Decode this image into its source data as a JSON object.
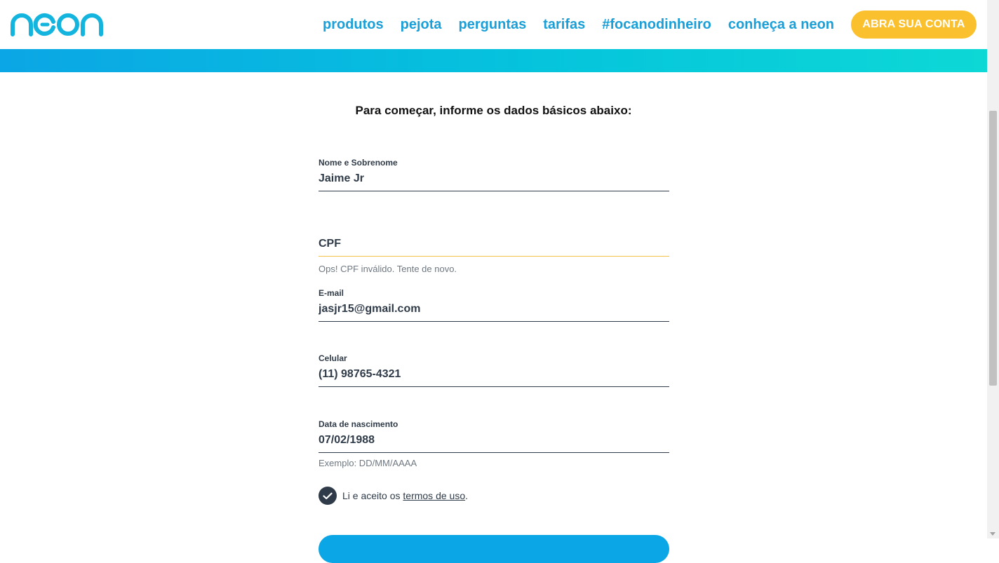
{
  "header": {
    "nav": [
      "produtos",
      "pejota",
      "perguntas",
      "tarifas",
      "#focanodinheiro",
      "conheça a neon"
    ],
    "cta": "ABRA SUA CONTA"
  },
  "form": {
    "title": "Para começar, informe os dados básicos abaixo:",
    "name": {
      "label": "Nome e Sobrenome",
      "value": "Jaime Jr"
    },
    "cpf": {
      "placeholder": "CPF",
      "error": "Ops! CPF inválido. Tente de novo."
    },
    "email": {
      "label": "E-mail",
      "value": "jasjr15@gmail.com"
    },
    "phone": {
      "label": "Celular",
      "value": "(11) 98765-4321"
    },
    "birth": {
      "label": "Data de nascimento",
      "value": "07/02/1988",
      "helper": "Exemplo: DD/MM/AAAA"
    },
    "terms": {
      "prefix": "Li e aceito os ",
      "link": "termos de uso",
      "suffix": ".",
      "checked": true
    }
  },
  "colors": {
    "brand": "#1a9fd8",
    "cta": "#fbc02d",
    "error": "#f4c44a",
    "text": "#2f3b48"
  },
  "icons": {
    "logo": "neon-logo",
    "check": "check-icon"
  }
}
